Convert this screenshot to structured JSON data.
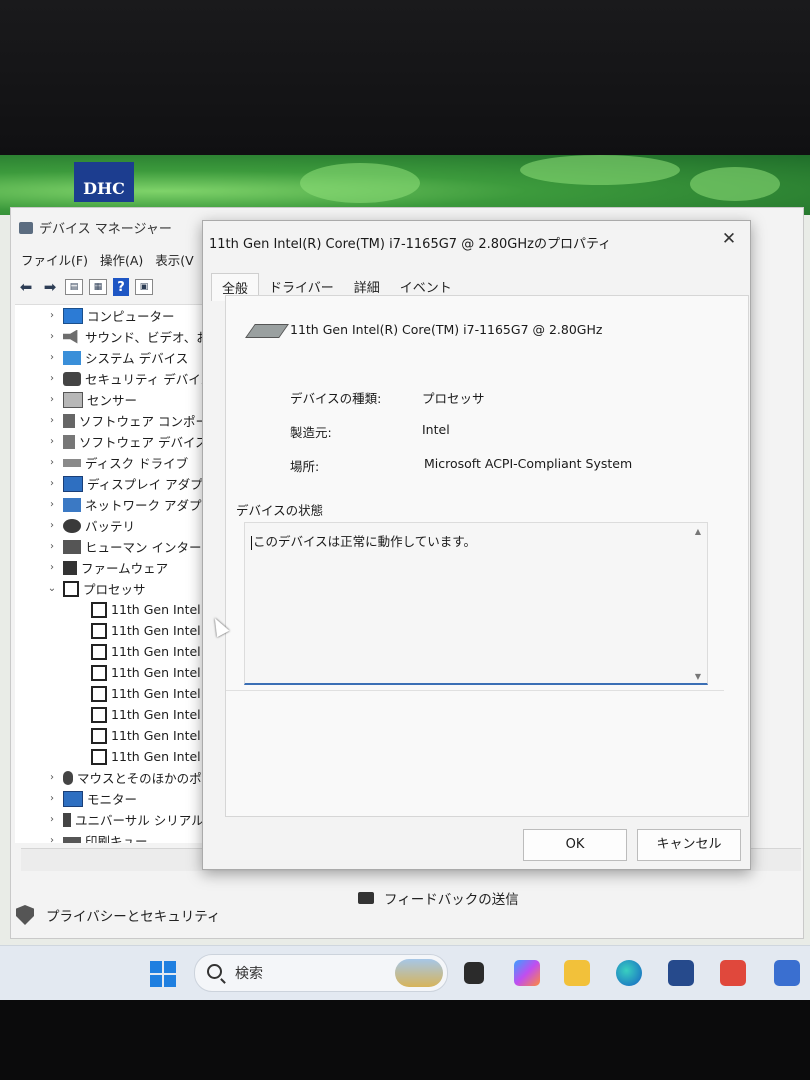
{
  "wallpaper": {
    "logo_text": "DHC"
  },
  "device_manager": {
    "title": "デバイス マネージャー",
    "menu": [
      "ファイル(F)",
      "操作(A)",
      "表示(V"
    ],
    "tree": [
      {
        "label": "コンピューター",
        "icon": "computer-icon",
        "expanded": false
      },
      {
        "label": "サウンド、ビデオ、およ",
        "icon": "speaker-icon",
        "expanded": false
      },
      {
        "label": "システム デバイス",
        "icon": "system-device-icon",
        "expanded": false
      },
      {
        "label": "セキュリティ デバイス",
        "icon": "security-device-icon",
        "expanded": false
      },
      {
        "label": "センサー",
        "icon": "sensor-icon",
        "expanded": false
      },
      {
        "label": "ソフトウェア コンポーネ",
        "icon": "software-component-icon",
        "expanded": false
      },
      {
        "label": "ソフトウェア デバイス",
        "icon": "software-device-icon",
        "expanded": false
      },
      {
        "label": "ディスク ドライブ",
        "icon": "disk-drive-icon",
        "expanded": false
      },
      {
        "label": "ディスプレイ アダプター",
        "icon": "display-adapter-icon",
        "expanded": false
      },
      {
        "label": "ネットワーク アダプター",
        "icon": "network-adapter-icon",
        "expanded": false
      },
      {
        "label": "バッテリ",
        "icon": "battery-icon",
        "expanded": false
      },
      {
        "label": "ヒューマン インターフェ",
        "icon": "hid-icon",
        "expanded": false
      },
      {
        "label": "ファームウェア",
        "icon": "firmware-icon",
        "expanded": false
      },
      {
        "label": "プロセッサ",
        "icon": "processor-icon",
        "expanded": true
      },
      {
        "label": "11th Gen Intel",
        "icon": "processor-icon",
        "child": true
      },
      {
        "label": "11th Gen Intel",
        "icon": "processor-icon",
        "child": true
      },
      {
        "label": "11th Gen Intel",
        "icon": "processor-icon",
        "child": true
      },
      {
        "label": "11th Gen Intel",
        "icon": "processor-icon",
        "child": true
      },
      {
        "label": "11th Gen Intel",
        "icon": "processor-icon",
        "child": true
      },
      {
        "label": "11th Gen Intel",
        "icon": "processor-icon",
        "child": true
      },
      {
        "label": "11th Gen Intel",
        "icon": "processor-icon",
        "child": true
      },
      {
        "label": "11th Gen Intel",
        "icon": "processor-icon",
        "child": true
      },
      {
        "label": "マウスとそのほかのポ",
        "icon": "mouse-icon",
        "expanded": false
      },
      {
        "label": "モニター",
        "icon": "monitor-icon",
        "expanded": false
      },
      {
        "label": "ユニバーサル シリアル",
        "icon": "usb-icon",
        "expanded": false
      },
      {
        "label": "印刷キュー",
        "icon": "printer-icon",
        "expanded": false
      }
    ]
  },
  "dialog": {
    "title": "11th Gen Intel(R) Core(TM) i7-1165G7 @ 2.80GHzのプロパティ",
    "close_label": "✕",
    "tabs": [
      "全般",
      "ドライバー",
      "詳細",
      "イベント"
    ],
    "device_name": "11th Gen Intel(R) Core(TM) i7-1165G7 @ 2.80GHz",
    "properties": [
      {
        "label": "デバイスの種類:",
        "value": "プロセッサ"
      },
      {
        "label": "製造元:",
        "value": "Intel"
      },
      {
        "label": "場所:",
        "value": "Microsoft ACPI-Compliant System"
      }
    ],
    "status_group_label": "デバイスの状態",
    "status_text": "このデバイスは正常に動作しています。",
    "ok_label": "OK",
    "cancel_label": "キャンセル"
  },
  "settings": {
    "feedback_label": "フィードバックの送信",
    "privacy_label": "プライバシーとセキュリティ"
  },
  "taskbar": {
    "search_label": "検索",
    "apps": [
      "file-explorer-icon",
      "copilot-icon",
      "folder-icon",
      "edge-icon",
      "store-icon",
      "app-red-icon",
      "mail-icon"
    ]
  }
}
